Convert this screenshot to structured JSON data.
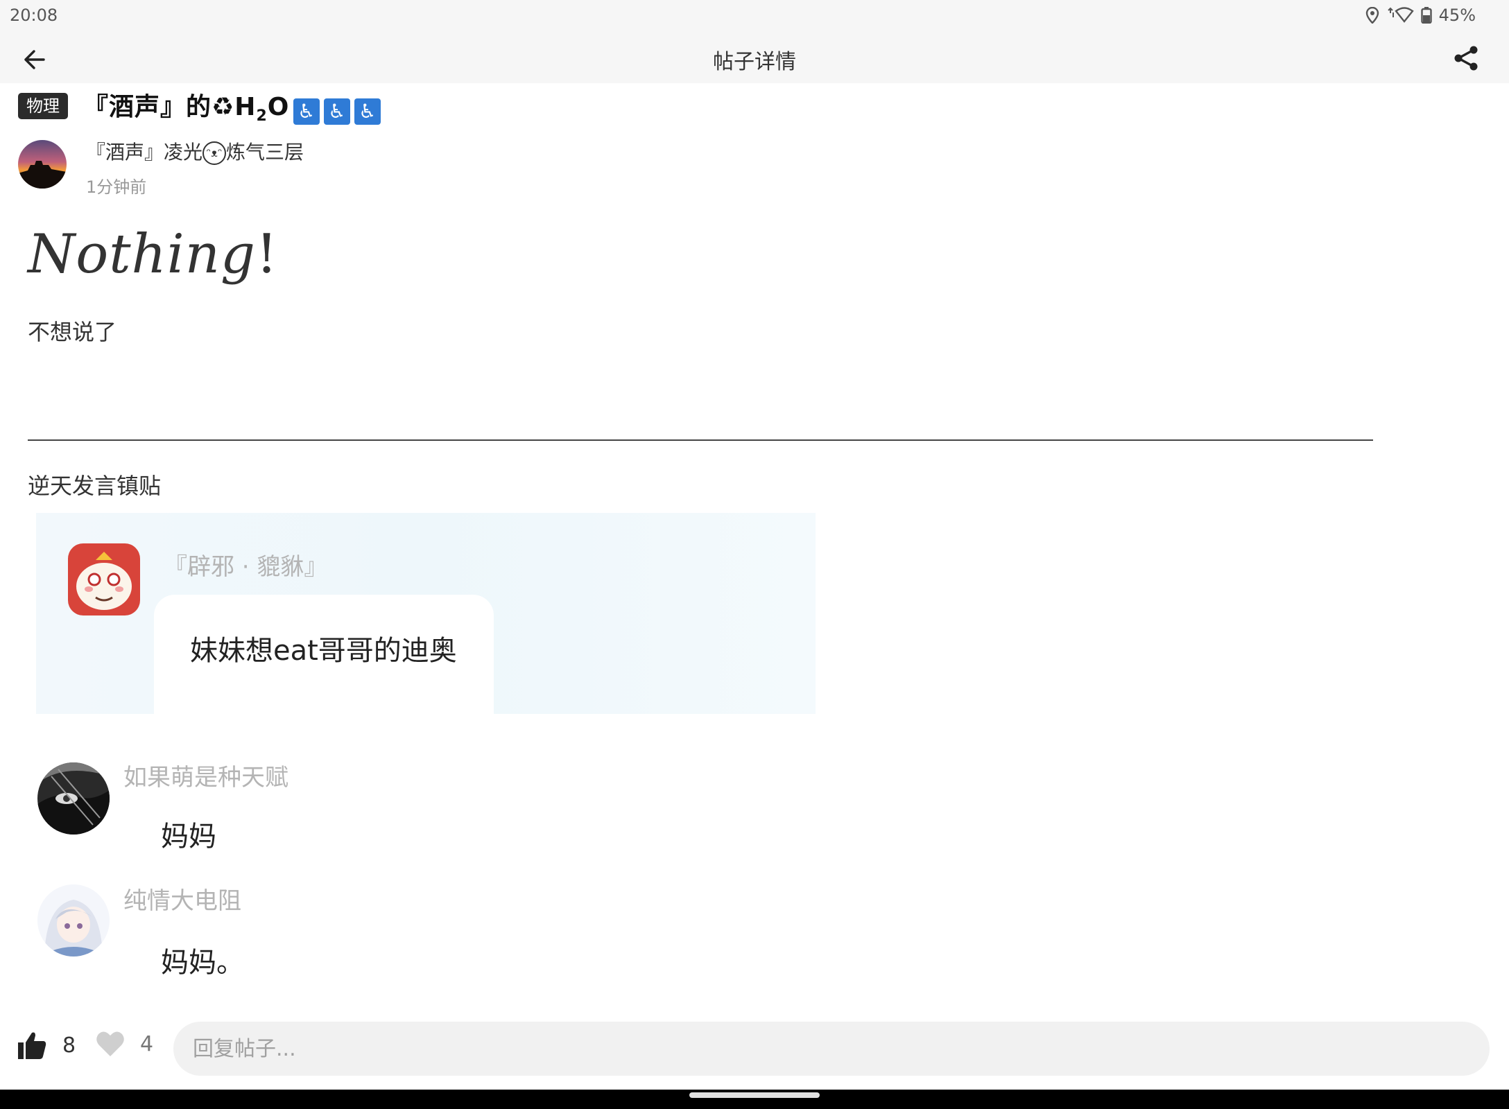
{
  "status_bar": {
    "time": "20:08",
    "battery": "45%"
  },
  "app_bar": {
    "title": "帖子详情"
  },
  "post": {
    "tag": "物理",
    "title_prefix": "『酒声』的",
    "title_recycle": "♻",
    "title_h": "H",
    "title_sub": "2",
    "title_o": "O",
    "title_icons": [
      "♿",
      "♿",
      "♿"
    ],
    "author_prefix": "『酒声』凌光",
    "author_face": "ᵔᴥᵔ",
    "author_suffix": "炼气三层",
    "time": "1分钟前",
    "heading_word": "Nothing",
    "heading_bang": "!",
    "body_line": "不想说了",
    "body_line2": "逆天发言镇贴"
  },
  "screenshot": {
    "messages": [
      {
        "name": "『辟邪 · 貔貅』",
        "text": "妹妹想eat哥哥的迪奥"
      },
      {
        "name": "如果萌是种天赋",
        "text": "妈妈"
      },
      {
        "name": "纯情大电阻",
        "text": "妈妈。"
      }
    ]
  },
  "bottom_bar": {
    "like_count": "8",
    "fav_count": "4",
    "reply_placeholder": "回复帖子..."
  },
  "colors": {
    "tag_bg": "#2b2b2b",
    "accessibility_icon": "#2f7bd6",
    "chat_name": "#b4b4b4"
  },
  "icons": [
    "back-arrow-icon",
    "share-icon",
    "location-icon",
    "wifi-icon",
    "battery-icon",
    "thumbs-up-icon",
    "heart-icon"
  ]
}
